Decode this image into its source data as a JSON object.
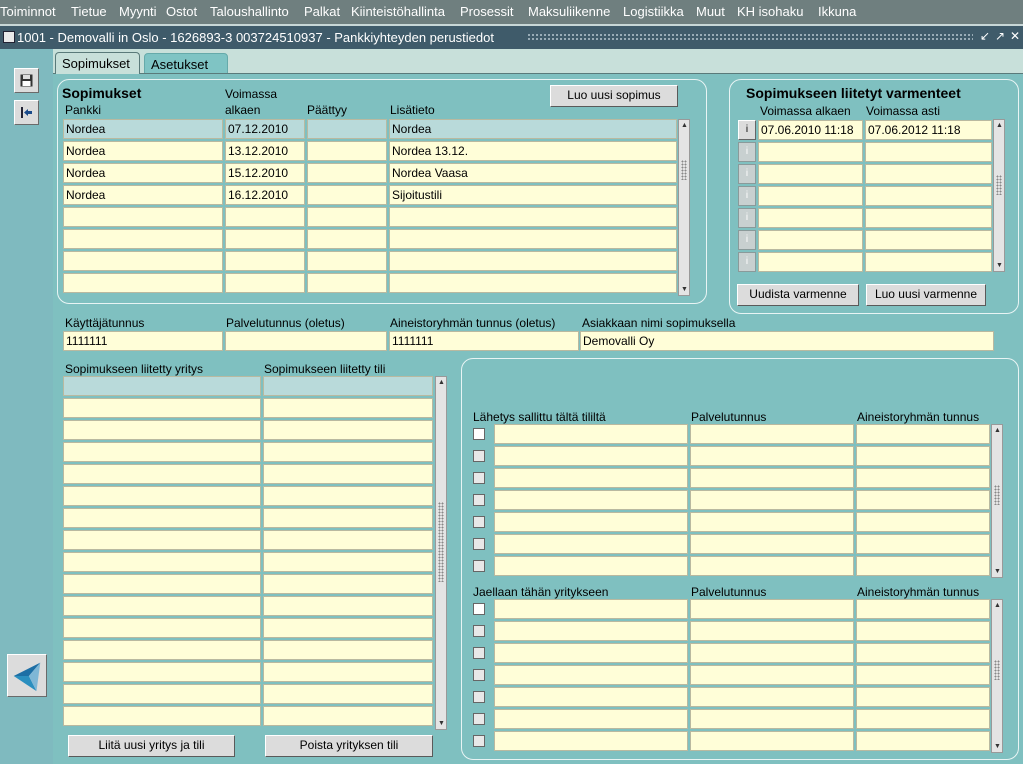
{
  "menu": [
    {
      "label": "Toiminnot"
    },
    {
      "label": "Tietue"
    },
    {
      "label": "Myynti"
    },
    {
      "label": "Ostot"
    },
    {
      "label": "Taloushallinto"
    },
    {
      "label": "Palkat"
    },
    {
      "label": "Kiinteistöhallinta"
    },
    {
      "label": "Prosessit"
    },
    {
      "label": "Maksuliikenne"
    },
    {
      "label": "Logistiikka"
    },
    {
      "label": "Muut"
    },
    {
      "label": "KH isohaku"
    },
    {
      "label": "Ikkuna"
    }
  ],
  "window": {
    "title": "1001 - Demovalli in Oslo - 1626893-3 003724510937 - Pankkiyhteyden perustiedot",
    "buttons": [
      "↙",
      "↗",
      "✕"
    ]
  },
  "toolbar": {
    "icons": [
      "save-icon",
      "exit-icon"
    ],
    "logo": "app-logo-icon"
  },
  "tabs": [
    {
      "label": "Sopimukset"
    },
    {
      "label": "Asetukset"
    }
  ],
  "contracts": {
    "heading": "Sopimukset",
    "new_button": "Luo uusi sopimus",
    "columns": [
      "Pankki",
      "Voimassa\nalkaen",
      "Päättyy",
      "Lisätieto"
    ],
    "col_voimassa_line1": "Voimassa",
    "col_voimassa_line2": "alkaen",
    "rows": [
      {
        "pankki": "Nordea",
        "alkaen": "07.12.2010",
        "paattyy": "",
        "lisatieto": "Nordea"
      },
      {
        "pankki": "Nordea",
        "alkaen": "13.12.2010",
        "paattyy": "",
        "lisatieto": "Nordea 13.12."
      },
      {
        "pankki": "Nordea",
        "alkaen": "15.12.2010",
        "paattyy": "",
        "lisatieto": "Nordea Vaasa"
      },
      {
        "pankki": "Nordea",
        "alkaen": "16.12.2010",
        "paattyy": "",
        "lisatieto": "Sijoitustili"
      },
      {
        "pankki": "",
        "alkaen": "",
        "paattyy": "",
        "lisatieto": ""
      },
      {
        "pankki": "",
        "alkaen": "",
        "paattyy": "",
        "lisatieto": ""
      },
      {
        "pankki": "",
        "alkaen": "",
        "paattyy": "",
        "lisatieto": ""
      },
      {
        "pankki": "",
        "alkaen": "",
        "paattyy": "",
        "lisatieto": ""
      }
    ]
  },
  "certificates": {
    "heading": "Sopimukseen liitetyt varmenteet",
    "col_from": "Voimassa alkaen",
    "col_to": "Voimassa asti",
    "info_label": "i",
    "rows": [
      {
        "from": "07.06.2010 11:18",
        "to": "07.06.2012 11:18"
      },
      {
        "from": "",
        "to": ""
      },
      {
        "from": "",
        "to": ""
      },
      {
        "from": "",
        "to": ""
      },
      {
        "from": "",
        "to": ""
      },
      {
        "from": "",
        "to": ""
      },
      {
        "from": "",
        "to": ""
      }
    ],
    "renew_button": "Uudista varmenne",
    "new_button": "Luo uusi varmenne"
  },
  "details": {
    "user_label": "Käyttäjätunnus",
    "user_value": "1111111",
    "service_label": "Palvelutunnus (oletus)",
    "service_value": "",
    "group_label": "Aineistoryhmän tunnus (oletus)",
    "group_value": "1111111",
    "customer_label": "Asiakkaan nimi sopimuksella",
    "customer_value": "Demovalli Oy"
  },
  "companies": {
    "col_company": "Sopimukseen liitetty yritys",
    "col_account": "Sopimukseen liitetty tili",
    "row_count": 16,
    "add_button": "Liitä uusi yritys ja tili",
    "remove_button": "Poista yrityksen tili"
  },
  "sending": {
    "col_allowed": "Lähetys sallittu tältä tililtä",
    "col_service": "Palvelutunnus",
    "col_group": "Aineistoryhmän tunnus",
    "row_count": 7
  },
  "sharing": {
    "col_shared": "Jaellaan tähän yritykseen",
    "col_service": "Palvelutunnus",
    "col_group": "Aineistoryhmän tunnus",
    "row_count": 7
  },
  "colors": {
    "menubar": "#6f7f7f",
    "titlebar": "#3f5b6a",
    "panel_bg": "#7fc0c0",
    "field_bg": "#fffed8"
  }
}
